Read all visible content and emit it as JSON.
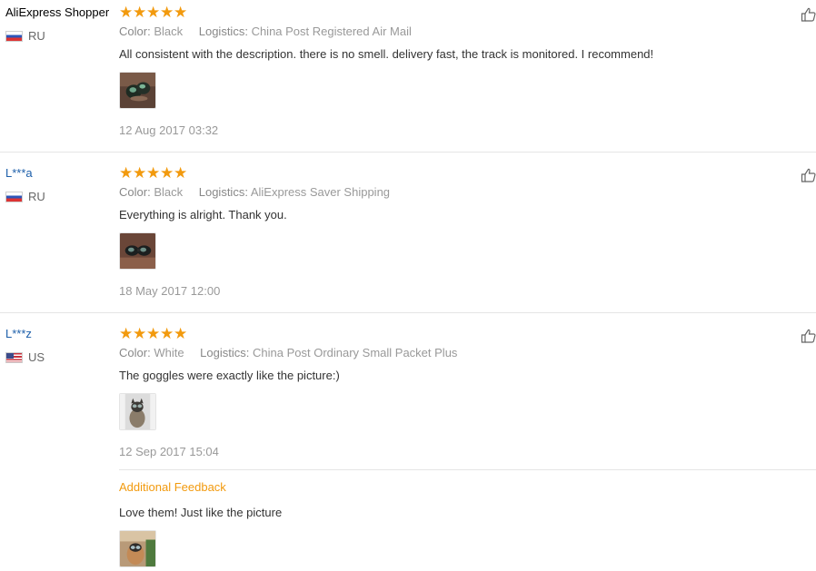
{
  "reviews": [
    {
      "user": "AliExpress Shopper",
      "country": "RU",
      "flag_icon": "russia-flag-icon",
      "stars": 5,
      "color_label": "Color:",
      "color": "Black",
      "logistics_label": "Logistics:",
      "logistics": "China Post Registered Air Mail",
      "comment": "All consistent with the description. there is no smell. delivery fast, the track is monitored. I recommend!",
      "date": "12 Aug 2017 03:32"
    },
    {
      "user": "L***a",
      "country": "RU",
      "flag_icon": "russia-flag-icon",
      "stars": 5,
      "color_label": "Color:",
      "color": "Black",
      "logistics_label": "Logistics:",
      "logistics": "AliExpress Saver Shipping",
      "comment": "Everything is alright. Thank you.",
      "date": "18 May 2017 12:00"
    },
    {
      "user": "L***z",
      "country": "US",
      "flag_icon": "usa-flag-icon",
      "stars": 5,
      "color_label": "Color:",
      "color": "White",
      "logistics_label": "Logistics:",
      "logistics": "China Post Ordinary Small Packet Plus",
      "comment": "The goggles were exactly like the picture:)",
      "date": "12 Sep 2017 15:04",
      "additional_feedback": {
        "title": "Additional Feedback",
        "comment": "Love them! Just like the picture"
      }
    }
  ],
  "icons": {
    "star": "star-icon",
    "like": "thumbs-up-icon"
  },
  "colors": {
    "star": "#f29a0e",
    "masked_user": "#1d5faa",
    "additional_title": "#f29a0e"
  }
}
